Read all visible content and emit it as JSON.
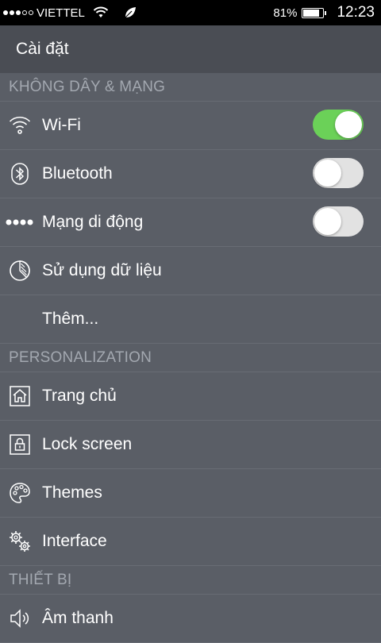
{
  "status_bar": {
    "carrier": "VIETTEL",
    "battery_text": "81%",
    "battery_level": 0.81,
    "time": "12:23",
    "signal_bars_filled": 3,
    "signal_bars_total": 5
  },
  "header": {
    "title": "Cài đặt"
  },
  "sections": {
    "wireless": {
      "title": "KHÔNG DÂY & MẠNG",
      "items": [
        {
          "label": "Wi-Fi",
          "icon": "wifi-icon",
          "toggle": true
        },
        {
          "label": "Bluetooth",
          "icon": "bluetooth-icon",
          "toggle": false
        },
        {
          "label": "Mạng di động",
          "icon": "mobile-network-icon",
          "toggle": false
        },
        {
          "label": "Sử dụng dữ liệu",
          "icon": "data-usage-icon"
        },
        {
          "label": "Thêm..."
        }
      ]
    },
    "personalization": {
      "title": "PERSONALIZATION",
      "items": [
        {
          "label": "Trang chủ",
          "icon": "home-icon"
        },
        {
          "label": "Lock screen",
          "icon": "lock-icon"
        },
        {
          "label": "Themes",
          "icon": "palette-icon"
        },
        {
          "label": "Interface",
          "icon": "gears-icon"
        }
      ]
    },
    "device": {
      "title": "THIẾT BỊ",
      "items": [
        {
          "label": "Âm thanh",
          "icon": "speaker-icon"
        }
      ]
    }
  },
  "colors": {
    "background": "#5a5e66",
    "header": "#4a4d54",
    "section_text": "#a3a8b0",
    "toggle_on": "#6bd158",
    "toggle_off": "#e2e2e2"
  }
}
